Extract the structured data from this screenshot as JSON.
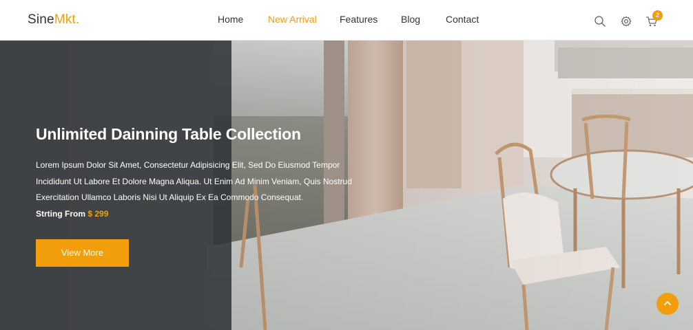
{
  "brand": {
    "name_part1": "Sine",
    "name_part2": "Mkt.",
    "accent_color": "#f29d0c"
  },
  "nav": {
    "items": [
      {
        "label": "Home",
        "active": false
      },
      {
        "label": "New Arrival",
        "active": true
      },
      {
        "label": "Features",
        "active": false
      },
      {
        "label": "Blog",
        "active": false
      },
      {
        "label": "Contact",
        "active": false
      }
    ]
  },
  "header_icons": {
    "search": "search-icon",
    "settings": "gear-icon",
    "cart": "cart-icon"
  },
  "cart": {
    "count": "2"
  },
  "hero": {
    "title": "Unlimited Dainning Table Collection",
    "description": "Lorem Ipsum Dolor Sit Amet, Consectetur Adipisicing Elit, Sed Do Eiusmod Tempor Incididunt Ut Labore Et Dolore Magna Aliqua. Ut Enim Ad Minim Veniam, Quis Nostrud Exercitation Ullamco Laboris Nisi Ut Aliquip Ex Ea Commodo Consequat.",
    "price_label": "Strting From",
    "price": "$ 299",
    "button_label": "View More"
  },
  "scroll_top": {
    "icon": "chevron-up-icon"
  }
}
